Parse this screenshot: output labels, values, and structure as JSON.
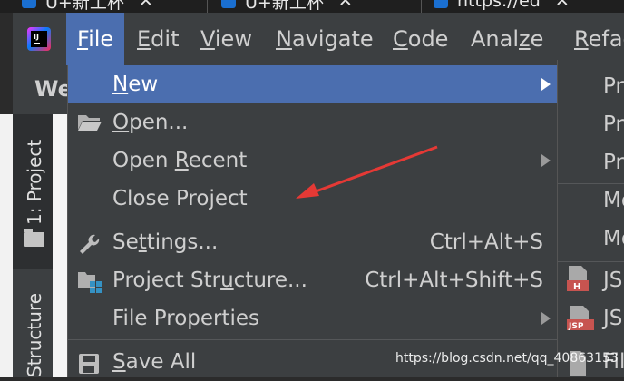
{
  "browser_tabs": [
    {
      "title": "U+新工杯"
    },
    {
      "title": "U+新工杯"
    },
    {
      "title": "https://ed"
    }
  ],
  "menubar": {
    "items": [
      {
        "label": "File",
        "mnemonic": "F",
        "rest": "ile"
      },
      {
        "label": "Edit",
        "mnemonic": "E",
        "rest": "dit"
      },
      {
        "label": "View",
        "mnemonic": "V",
        "rest": "iew"
      },
      {
        "label": "Navigate",
        "mnemonic": "N",
        "rest": "avigate"
      },
      {
        "label": "Code",
        "mnemonic": "C",
        "rest": "ode"
      },
      {
        "label": "Analyze",
        "mnemonic": "z",
        "pre": "Anal",
        "post": "e"
      },
      {
        "label": "Refac",
        "mnemonic": "R",
        "rest": "efac"
      }
    ]
  },
  "background": {
    "welcome_fragment": "We",
    "side_tab_project": "1: Project",
    "side_tab_structure": "Structure"
  },
  "file_menu": {
    "new": {
      "label": "New",
      "has_submenu": true
    },
    "open": {
      "label": "Open..."
    },
    "open_recent": {
      "label": "Open Recent",
      "has_submenu": true
    },
    "close_project": {
      "label": "Close Project"
    },
    "settings": {
      "label": "Settings...",
      "shortcut": "Ctrl+Alt+S"
    },
    "project_structure": {
      "label": "Project Structure...",
      "shortcut": "Ctrl+Alt+Shift+S"
    },
    "file_properties": {
      "label": "File Properties",
      "has_submenu": true
    },
    "save_all": {
      "label": "Save All",
      "shortcut": "Ctrl+S"
    }
  },
  "new_submenu": {
    "items": [
      "Pr",
      "Pr",
      "Pr",
      "Mo",
      "Mo",
      "JS",
      "JS",
      "Fil"
    ]
  },
  "annotation": {
    "color": "#e53935"
  },
  "watermark": "https://blog.csdn.net/qq_40863153",
  "colors": {
    "highlight": "#4b6eaf",
    "menu_bg": "#3c3f41"
  }
}
